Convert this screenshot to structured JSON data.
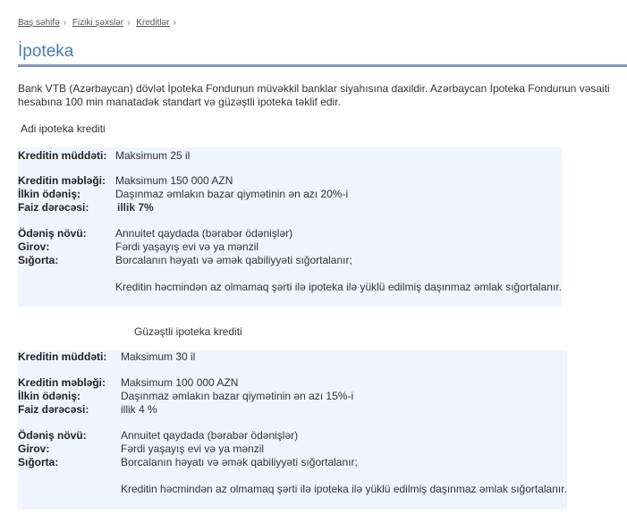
{
  "breadcrumb": [
    "Baş səhifə",
    "Fiziki şəxslər",
    "Kreditlər"
  ],
  "page_title": "İpoteka",
  "intro": "Bank VTB (Azərbaycan) dövlət İpoteka Fondunun müvəkkil banklar siyahısına daxildir.  Azərbaycan İpoteka Fondunun vəsaiti hesabına 100 min manatadək standart və güzəştli ipoteka təklif edir.",
  "sections": [
    {
      "title": "Adi ipoteka krediti",
      "rows": {
        "term_label": "Kreditin müddəti:",
        "term": "Maksimum 25 il",
        "amount_label": "Kreditin məbləği:",
        "amount": "Maksimum 150 000 AZN",
        "down_label": "İlkin ödəniş:",
        "down": "Daşınmaz əmlakın bazar qiymətinin ən azı 20%-i",
        "rate_label": "Faiz dərəcəsi:",
        "rate": "illik 7%",
        "payment_label": "Ödəniş növü:",
        "payment": "Annuitet qaydada (bərabər ödənişlər)",
        "pledge_label": "Girov:",
        "pledge": "Fərdi yaşayış evi və ya mənzil",
        "insurance_label": "Sığorta:",
        "insurance": "Borcalanın həyatı və əmək qabiliyyəti sığortalanır;",
        "note": "Kreditin həcmindən az olmamaq şərti ilə ipoteka ilə yüklü edilmiş daşınmaz əmlak sığortalanır."
      }
    },
    {
      "title": "Güzəştli ipoteka krediti",
      "rows": {
        "term_label": "Kreditin müddəti:",
        "term": "Maksimum 30 il",
        "amount_label": "Kreditin məbləği:",
        "amount": "Maksimum 100 000 AZN",
        "down_label": "İlkin ödəniş:",
        "down": "Daşınmaz əmlakın bazar qiymətinin ən azı 15%-i",
        "rate_label": "Faiz dərəcəsi:",
        "rate": "illik 4 %",
        "payment_label": "Ödəniş növü:",
        "payment": "Annuitet qaydada (bərabər ödənişlər)",
        "pledge_label": "Girov:",
        "pledge": "Fərdi yaşayış evi və ya mənzil",
        "insurance_label": "Sığorta:",
        "insurance": "Borcalanın həyatı və əmək qabiliyyəti sığortalanır;",
        "note": "Kreditin həcmindən az olmamaq şərti ilə ipoteka ilə yüklü edilmiş daşınmaz əmlak sığortalanır."
      }
    }
  ]
}
